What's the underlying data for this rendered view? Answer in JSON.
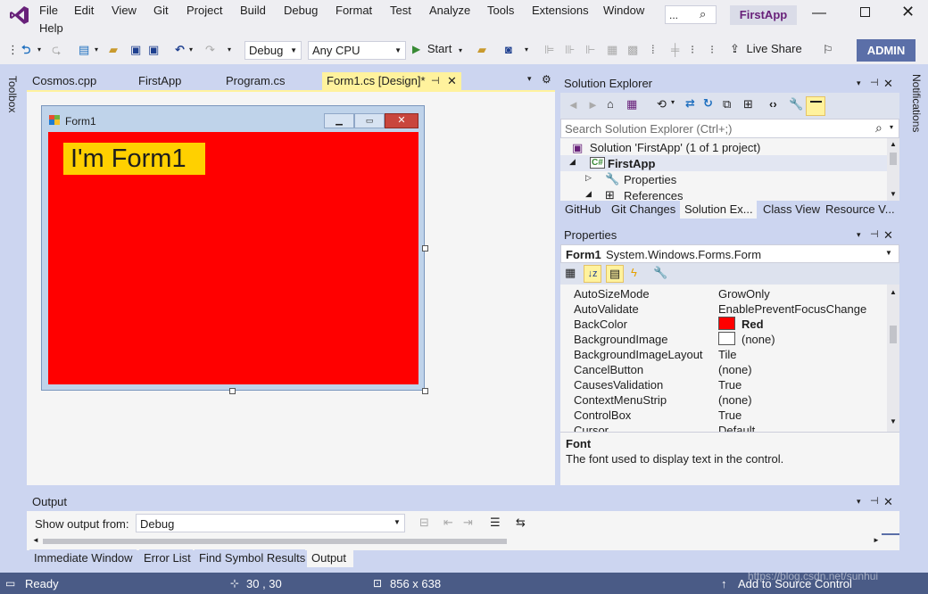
{
  "menu": {
    "items": [
      "File",
      "Edit",
      "View",
      "Git",
      "Project",
      "Build",
      "Debug",
      "Format",
      "Test",
      "Analyze",
      "Tools",
      "Extensions",
      "Window",
      "Help"
    ],
    "search_placeholder": "...",
    "app_name": "FirstApp"
  },
  "toolbar": {
    "config": "Debug",
    "platform": "Any CPU",
    "start": "Start",
    "live_share": "Live Share",
    "admin": "ADMIN"
  },
  "left_strip": {
    "toolbox": "Toolbox"
  },
  "right_strip": {
    "notifications": "Notifications"
  },
  "doc_tabs": [
    "Cosmos.cpp",
    "FirstApp",
    "Program.cs",
    "Form1.cs [Design]*"
  ],
  "designer": {
    "form_title": "Form1",
    "label_text": "I'm Form1",
    "form_color": "#FF0000",
    "label_color": "#FFD000"
  },
  "solution_explorer": {
    "title": "Solution Explorer",
    "search_placeholder": "Search Solution Explorer (Ctrl+;)",
    "tree": {
      "solution": "Solution 'FirstApp' (1 of 1 project)",
      "project": "FirstApp",
      "properties": "Properties",
      "references": "References"
    },
    "tabs": [
      "GitHub",
      "Git Changes",
      "Solution Ex...",
      "Class View",
      "Resource V..."
    ]
  },
  "properties": {
    "title": "Properties",
    "object_name": "Form1",
    "object_type": "System.Windows.Forms.Form",
    "rows": [
      {
        "name": "AutoSizeMode",
        "value": "GrowOnly"
      },
      {
        "name": "AutoValidate",
        "value": "EnablePreventFocusChange"
      },
      {
        "name": "BackColor",
        "value": "Red"
      },
      {
        "name": "BackgroundImage",
        "value": "(none)"
      },
      {
        "name": "BackgroundImageLayout",
        "value": "Tile"
      },
      {
        "name": "CancelButton",
        "value": "(none)"
      },
      {
        "name": "CausesValidation",
        "value": "True"
      },
      {
        "name": "ContextMenuStrip",
        "value": "(none)"
      },
      {
        "name": "ControlBox",
        "value": "True"
      },
      {
        "name": "Cursor",
        "value": "Default"
      }
    ],
    "desc_title": "Font",
    "desc_text": "The font used to display text in the control."
  },
  "output": {
    "title": "Output",
    "show_from_label": "Show output from:",
    "show_from_value": "Debug",
    "tabs": [
      "Immediate Window",
      "Error List",
      "Find Symbol Results",
      "Output"
    ]
  },
  "status": {
    "ready": "Ready",
    "position": "30 , 30",
    "size": "856 x 638",
    "source_control": "Add to Source Control",
    "watermark": "https://blog.csdn.net/sunhui"
  },
  "colors": {
    "accent": "#68217A",
    "statusbar": "#4A5B86",
    "active_tab": "#FFF29D",
    "admin_bg": "#5B6FA8"
  }
}
